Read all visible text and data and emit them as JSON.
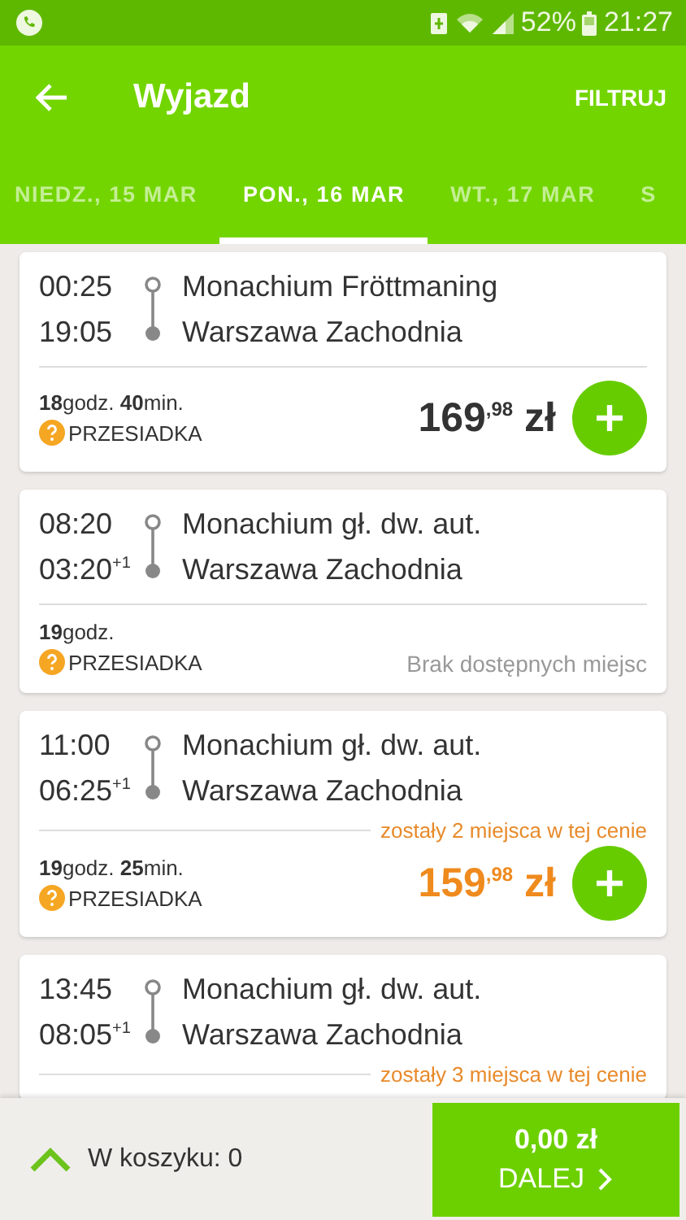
{
  "status_bar": {
    "battery": "52%",
    "time": "21:27"
  },
  "app_bar": {
    "title": "Wyjazd",
    "action": "FILTRUJ"
  },
  "tabs": [
    {
      "label": "NIEDZ., 15 MAR",
      "selected": false
    },
    {
      "label": "PON., 16 MAR",
      "selected": true
    },
    {
      "label": "WT., 17 MAR",
      "selected": false
    },
    {
      "label": "S",
      "selected": false
    }
  ],
  "connections": [
    {
      "kind": "price",
      "departure": "00:25",
      "arrival": "19:05",
      "from": "Monachium Fröttmaning",
      "to": "Warszawa Zachodnia",
      "duration": "**18**godz. **40**min.",
      "transfer": "PRZESIADKA",
      "price_main": "169",
      "price_decimal": ",98",
      "currency": "zł",
      "highlighted": false
    },
    {
      "kind": "sold_out",
      "departure": "08:20",
      "arrival": "03:20",
      "day_offset": "+1",
      "from": "Monachium gł. dw. aut.",
      "to": "Warszawa Zachodnia",
      "duration": "**19**godz.",
      "transfer": "PRZESIADKA",
      "availability": "Brak dostępnych miejsc"
    },
    {
      "kind": "price",
      "departure": "11:00",
      "arrival": "06:25",
      "day_offset": "+1",
      "from": "Monachium gł. dw. aut.",
      "to": "Warszawa Zachodnia",
      "seats_note": "zostały 2 miejsca w tej cenie",
      "duration": "**19**godz. **25**min.",
      "transfer": "PRZESIADKA",
      "price_main": "159",
      "price_decimal": ",98",
      "currency": "zł",
      "highlighted": true
    },
    {
      "kind": "partial",
      "departure": "13:45",
      "arrival": "08:05",
      "day_offset": "+1",
      "from": "Monachium gł. dw. aut.",
      "to": "Warszawa Zachodnia",
      "seats_note": "zostały 3 miejsca w tej cenie"
    }
  ],
  "cart": {
    "label": "W koszyku: 0",
    "total": "0,00 zł",
    "next": "DALEJ"
  }
}
